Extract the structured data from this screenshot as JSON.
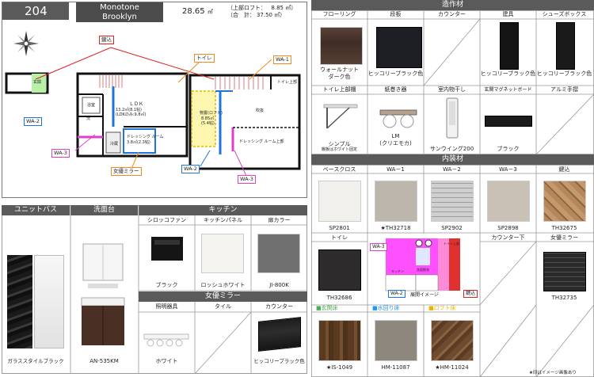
{
  "unit": {
    "room_number": "204",
    "style_line1": "Monotone",
    "style_line2": "Brooklyn",
    "area_total": "28.65",
    "area_unit": "㎡",
    "loft_label": "上部ロフト",
    "loft_area": "8.85",
    "sum_label": "合　計",
    "sum_area": "37.50"
  },
  "floorplan": {
    "tags": {
      "entry": "鍵込",
      "toilet": "トイレ",
      "wa1": "WA-1",
      "wa2_left": "WA-2",
      "wa3_left": "WA-3",
      "wa2_right": "WA-2",
      "wa3_right": "WA-3",
      "mirror": "女優ミラー"
    },
    "rooms": {
      "ldk": "ＬＤＫ",
      "ldk_size1": "13.2㎡(8.1帖)",
      "ldk_size2": "(LDKのみ:9.8㎡)",
      "storage": "物置(ロフト)",
      "storage_size1": "8.85㎡",
      "storage_size2": "(5.4帖)",
      "dressing": "ドレッシング ルーム",
      "dressing_size": "3.8㎡(2.3帖)",
      "loft_right": "吹抜",
      "dressing_upper": "ドレッシング ルーム上部",
      "toilet_upper": "トイレ上部",
      "entrance": "玄関",
      "bath": "浴室",
      "washer": "洗",
      "fridge": "冷蔵"
    }
  },
  "zosaku": {
    "section_title": "造作材",
    "headers": [
      "フローリング",
      "段板",
      "カウンター",
      "建具",
      "シューズボックス"
    ],
    "row1": [
      "ウォールナット\nダーク色",
      "ヒッコリーブラック色",
      "",
      "ヒッコリーブラック色",
      "ヒッコリーブラック色"
    ],
    "headers2": [
      "トイレ上部棚",
      "紙巻き器",
      "室内物干し",
      "玄関マグネットボード",
      "アルミ手摺"
    ],
    "row2_line1": [
      "シンプル",
      "LM",
      "サンウイング200",
      "ブラック",
      ""
    ],
    "row2_line2": [
      "棚板はホワイト固定",
      "(クリエモカ)",
      "",
      "",
      ""
    ]
  },
  "naiso": {
    "section_title": "内装材",
    "headers": [
      "ベースクロス",
      "WA－1",
      "WA－2",
      "WA－3",
      "鍵込"
    ],
    "codes": [
      "SP2801",
      "★TH32718",
      "SP2902",
      "SP2898",
      "TH32675"
    ],
    "headers2": [
      "トイレ",
      "",
      "カウンター下",
      "女優ミラー"
    ],
    "codes2": [
      "TH32686",
      "TH32735"
    ],
    "mini_labels": {
      "wa3": "WA-3",
      "wa2": "WA-2",
      "caption": "展開イメージ",
      "entry": "鍵込",
      "toilet_up": "トイレ上部",
      "kitchen": "キッチン",
      "wash": "洗面脱衣"
    },
    "legend": [
      "■玄関床",
      "■水回り床",
      "■ロフト床"
    ],
    "legend_colors": [
      "#4caf50",
      "#2196f3",
      "#f0b000"
    ],
    "floor_codes": [
      "★IS-1049",
      "HM-11087",
      "★HM-11024"
    ]
  },
  "bottom_left": {
    "headers": [
      "ユニットバス",
      "洗面台",
      "キッチン"
    ],
    "sub_headers": [
      "シロッコファン",
      "キッチンパネル",
      "扉カラー"
    ],
    "bath_label": "ガラススタイルブラック",
    "vanity_label": "AN-535KM",
    "kitchen_labels": [
      "ブラック",
      "ロッシュホワイト",
      "JI-800K"
    ],
    "mirror_title": "女優ミラー",
    "mirror_headers": [
      "照明器具",
      "タイル",
      "カウンター"
    ],
    "mirror_labels": [
      "ホワイト",
      "",
      "ヒッコリーブラック色"
    ]
  },
  "footnote": "★印はイメージ画像あり"
}
